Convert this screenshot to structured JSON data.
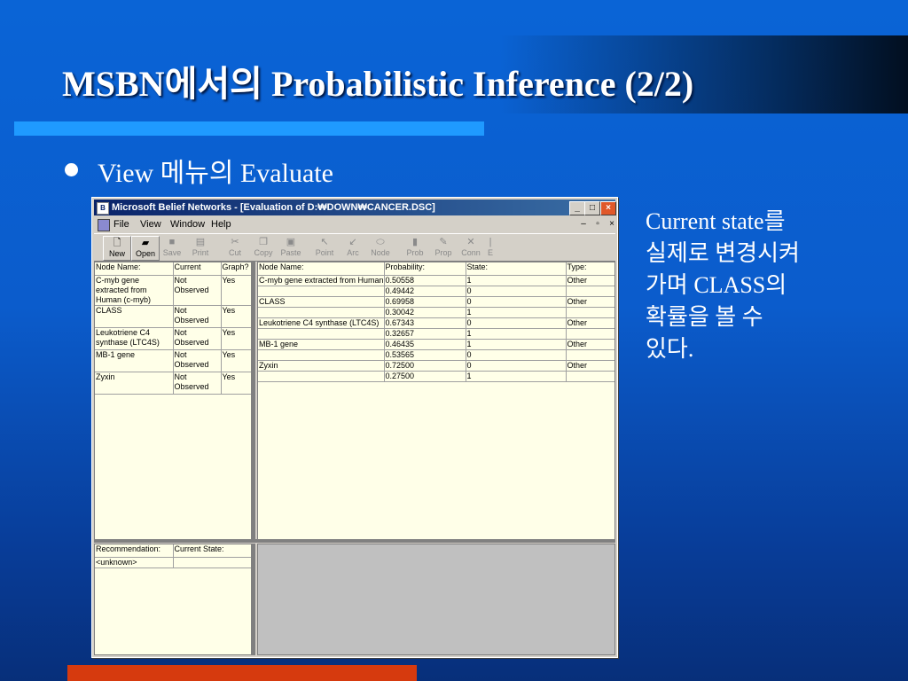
{
  "slide": {
    "title": "MSBN에서의 Probabilistic Inference (2/2)",
    "bullet": "View 메뉴의 Evaluate",
    "note_lines": [
      "Current state를",
      "실제로 변경시켜",
      "가며 CLASS의",
      "확률을 볼 수",
      "있다."
    ]
  },
  "window": {
    "title": "Microsoft Belief Networks - [Evaluation of D:₩DOWN₩CANCER.DSC]",
    "menu": [
      "File",
      "View",
      "Window",
      "Help"
    ],
    "toolbar": [
      {
        "label": "New",
        "icon": "new-doc-icon",
        "enabled": true
      },
      {
        "label": "Open",
        "icon": "open-folder-icon",
        "enabled": true
      },
      {
        "label": "Save",
        "icon": "save-icon",
        "enabled": false
      },
      {
        "label": "Print",
        "icon": "print-icon",
        "enabled": false
      },
      {
        "label": "Cut",
        "icon": "cut-icon",
        "enabled": false
      },
      {
        "label": "Copy",
        "icon": "copy-icon",
        "enabled": false
      },
      {
        "label": "Paste",
        "icon": "paste-icon",
        "enabled": false
      },
      {
        "label": "Point",
        "icon": "pointer-icon",
        "enabled": false
      },
      {
        "label": "Arc",
        "icon": "arc-icon",
        "enabled": false
      },
      {
        "label": "Node",
        "icon": "node-icon",
        "enabled": false
      },
      {
        "label": "Prob",
        "icon": "prob-icon",
        "enabled": false
      },
      {
        "label": "Prop",
        "icon": "prop-icon",
        "enabled": false
      },
      {
        "label": "Conn",
        "icon": "conn-icon",
        "enabled": false
      },
      {
        "label": "E",
        "icon": "e-icon",
        "enabled": false
      }
    ],
    "left_table": {
      "headers": [
        "Node Name:",
        "Current",
        "Graph?"
      ],
      "rows": [
        {
          "name": "C-myb gene extracted from Human (c-myb)",
          "state": "Not Observed",
          "graph": "Yes"
        },
        {
          "name": "CLASS",
          "state": "Not Observed",
          "graph": "Yes"
        },
        {
          "name": "Leukotriene C4 synthase (LTC4S)",
          "state": "Not Observed",
          "graph": "Yes"
        },
        {
          "name": "MB-1 gene",
          "state": "Not Observed",
          "graph": "Yes"
        },
        {
          "name": "Zyxin",
          "state": "Not Observed",
          "graph": "Yes"
        }
      ]
    },
    "right_table": {
      "headers": [
        "Node Name:",
        "Probability:",
        "State:",
        "Type:"
      ],
      "rows": [
        {
          "name": "C-myb gene extracted from Human",
          "prob": "0.50558",
          "state": "1",
          "type": "Other"
        },
        {
          "name": "",
          "prob": "0.49442",
          "state": "0",
          "type": ""
        },
        {
          "name": "CLASS",
          "prob": "0.69958",
          "state": "0",
          "type": "Other"
        },
        {
          "name": "",
          "prob": "0.30042",
          "state": "1",
          "type": ""
        },
        {
          "name": "Leukotriene C4 synthase (LTC4S)",
          "prob": "0.67343",
          "state": "0",
          "type": "Other"
        },
        {
          "name": "",
          "prob": "0.32657",
          "state": "1",
          "type": ""
        },
        {
          "name": "MB-1 gene",
          "prob": "0.46435",
          "state": "1",
          "type": "Other"
        },
        {
          "name": "",
          "prob": "0.53565",
          "state": "0",
          "type": ""
        },
        {
          "name": "Zyxin",
          "prob": "0.72500",
          "state": "0",
          "type": "Other"
        },
        {
          "name": "",
          "prob": "0.27500",
          "state": "1",
          "type": ""
        }
      ]
    },
    "recommend_table": {
      "headers": [
        "Recommendation:",
        "Current State:"
      ],
      "rows": [
        {
          "rec": "<unknown>",
          "state": ""
        }
      ]
    }
  }
}
